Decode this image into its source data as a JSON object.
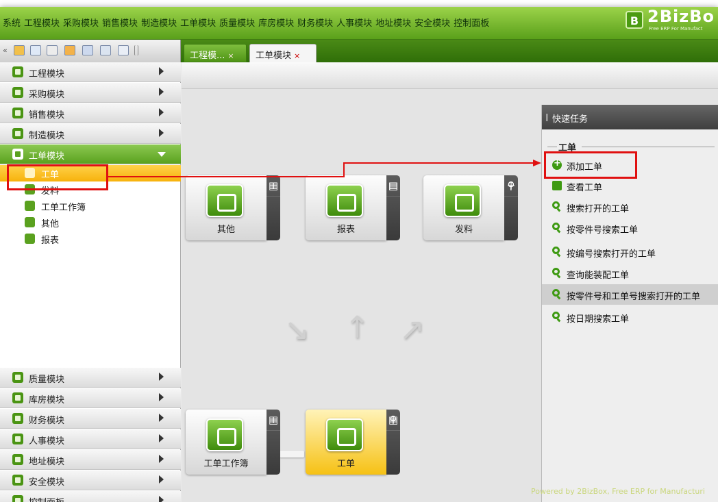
{
  "menu": [
    "系统",
    "工程模块",
    "采购模块",
    "销售模块",
    "制造模块",
    "工单模块",
    "质量模块",
    "库房模块",
    "财务模块",
    "人事模块",
    "地址模块",
    "安全模块",
    "控制面板"
  ],
  "logo": {
    "badge": "B",
    "name": "2BizBo",
    "tagline": "Free ERP For Manufact"
  },
  "toolbar_icons": [
    "collapse-icon",
    "users-icon",
    "mail-icon",
    "documents-icon",
    "chart-icon",
    "window-icon",
    "settings-icon",
    "home-icon",
    "separator-icon"
  ],
  "tabs": [
    {
      "label": "工程模...",
      "close": "×"
    },
    {
      "label": "工单模块",
      "close": "×"
    }
  ],
  "sidebar": {
    "top_modules": [
      "工程模块",
      "采购模块",
      "销售模块",
      "制造模块"
    ],
    "open_module": "工单模块",
    "sub_items": [
      "工单",
      "发料",
      "工单工作簿",
      "其他",
      "报表"
    ],
    "selected_sub": "工单",
    "bottom_modules": [
      "质量模块",
      "库房模块",
      "财务模块",
      "人事模块",
      "地址模块",
      "安全模块",
      "控制面板"
    ]
  },
  "tiles": [
    {
      "label": "其他",
      "buttons": [
        "+",
        "▤",
        "+"
      ]
    },
    {
      "label": "报表",
      "buttons": [
        "▤",
        "▤",
        "▤"
      ]
    },
    {
      "label": "发料",
      "buttons": [
        "+",
        "⚲",
        "⚲"
      ]
    },
    {
      "label": "工单工作簿",
      "buttons": [
        "+",
        "▤",
        ""
      ]
    },
    {
      "label": "工单",
      "buttons": [
        "+",
        "▤",
        "⚲"
      ]
    }
  ],
  "flow_arrows": [
    "↘",
    "↑",
    "↗"
  ],
  "quick_tasks": {
    "title": "快速任务",
    "section": "工单",
    "items": [
      "添加工单",
      "查看工单",
      "搜索打开的工单",
      "按零件号搜索工单",
      "按编号搜索打开的工单",
      "查询能装配工单",
      "按零件号和工单号搜索打开的工单",
      "按日期搜索工单"
    ]
  },
  "footer": "Powered by 2BizBox, Free ERP for Manufacturi",
  "colors": {
    "brand_green": "#5aa01b",
    "highlight_yellow": "#f7b20c",
    "annotation_red": "#e01010"
  }
}
